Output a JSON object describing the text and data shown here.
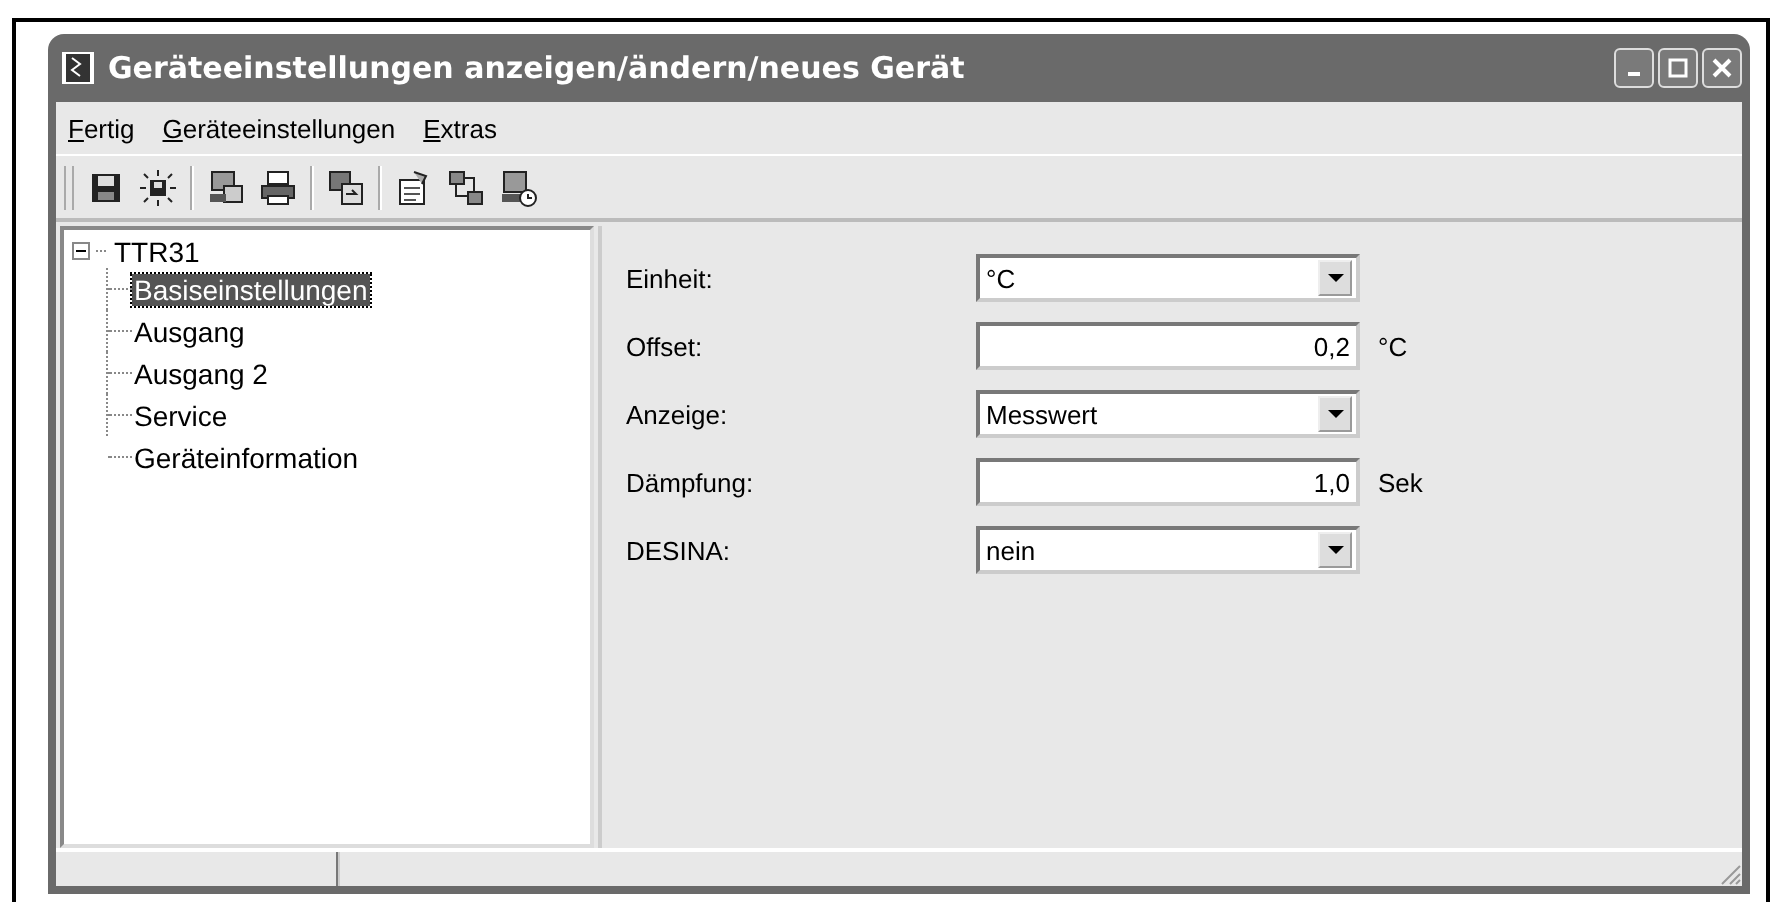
{
  "window": {
    "title": "Geräteeinstellungen anzeigen/ändern/neues Gerät"
  },
  "menu": [
    {
      "label": "Fertig"
    },
    {
      "label": "Geräteeinstellungen"
    },
    {
      "label": "Extras"
    }
  ],
  "tree": {
    "label": "TTR31",
    "expanded": true,
    "children": [
      {
        "label": "Basiseinstellungen",
        "selected": true
      },
      {
        "label": "Ausgang",
        "selected": false
      },
      {
        "label": "Ausgang 2",
        "selected": false
      },
      {
        "label": "Service",
        "selected": false
      },
      {
        "label": "Geräteinformation",
        "selected": false
      }
    ]
  },
  "form": [
    {
      "kind": "dropdown",
      "label": "Einheit:",
      "value": "°C"
    },
    {
      "kind": "number",
      "label": "Offset:",
      "value": "0,2",
      "unit": "°C"
    },
    {
      "kind": "dropdown",
      "label": "Anzeige:",
      "value": "Messwert"
    },
    {
      "kind": "number",
      "label": "Dämpfung:",
      "value": "1,0",
      "unit": "Sek"
    },
    {
      "kind": "dropdown",
      "label": "DESINA:",
      "value": "nein"
    }
  ]
}
